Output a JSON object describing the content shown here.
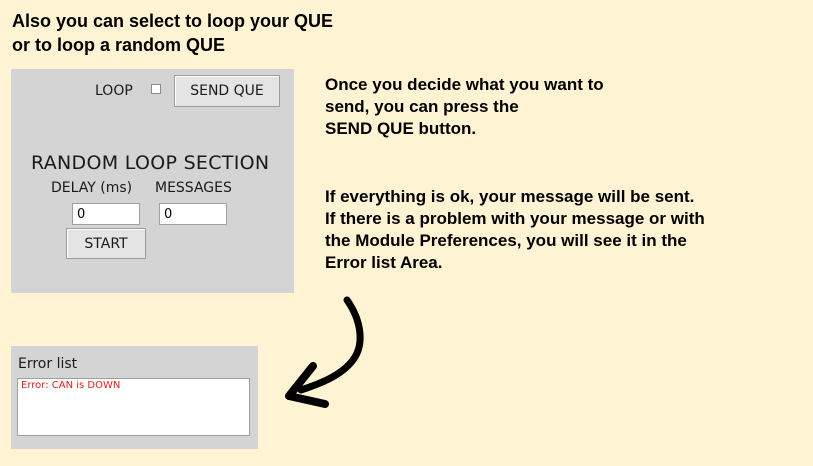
{
  "heading": {
    "line1": "Also you can select to loop your QUE",
    "line2": "or to loop a random QUE"
  },
  "panel": {
    "loop_label": "LOOP",
    "loop_checked": false,
    "send_button": "SEND QUE",
    "section_title": "RANDOM LOOP SECTION",
    "delay_label": "DELAY (ms)",
    "messages_label": "MESSAGES",
    "delay_value": "0",
    "messages_value": "0",
    "start_button": "START"
  },
  "explanation": {
    "block1": [
      "Once you decide what you want to",
      "send, you can press the",
      "SEND QUE button."
    ],
    "block2": [
      "If everything is ok, your message will be sent.",
      "If there is a problem with your message or with",
      "the Module Preferences, you will see it in the",
      "Error list Area."
    ]
  },
  "error_list": {
    "title": "Error list",
    "items": [
      "Error: CAN is DOWN"
    ],
    "error_color": "#e02020"
  },
  "colors": {
    "background": "#fef3d3",
    "panel": "#d4d4d4"
  }
}
